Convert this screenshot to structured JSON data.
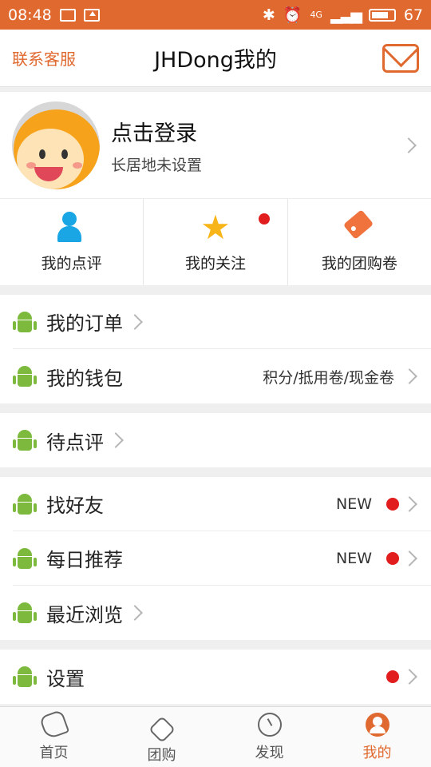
{
  "status_bar": {
    "time": "08:48",
    "signal_label": "4G",
    "battery": "67",
    "battery_level": 0.67
  },
  "header": {
    "service_label": "联系客服",
    "title": "JHDong我的"
  },
  "profile": {
    "name": "点击登录",
    "subtitle": "长居地未设置"
  },
  "quick_links": [
    {
      "label": "我的点评"
    },
    {
      "label": "我的关注"
    },
    {
      "label": "我的团购卷"
    }
  ],
  "groups": [
    [
      {
        "label": "我的订单",
        "note": ""
      },
      {
        "label": "我的钱包",
        "note": "积分/抵用卷/现金卷"
      }
    ],
    [
      {
        "label": "待点评",
        "note": ""
      }
    ],
    [
      {
        "label": "找好友",
        "note": "NEW"
      },
      {
        "label": "每日推荐",
        "note": "NEW"
      },
      {
        "label": "最近浏览",
        "note": ""
      }
    ],
    [
      {
        "label": "设置",
        "note": ""
      }
    ]
  ],
  "tabbar": [
    {
      "label": "首页"
    },
    {
      "label": "团购"
    },
    {
      "label": "发现"
    },
    {
      "label": "我的"
    }
  ],
  "colors": {
    "accent": "#e0692f",
    "badge": "#e21d1d",
    "android": "#7cb93d"
  }
}
